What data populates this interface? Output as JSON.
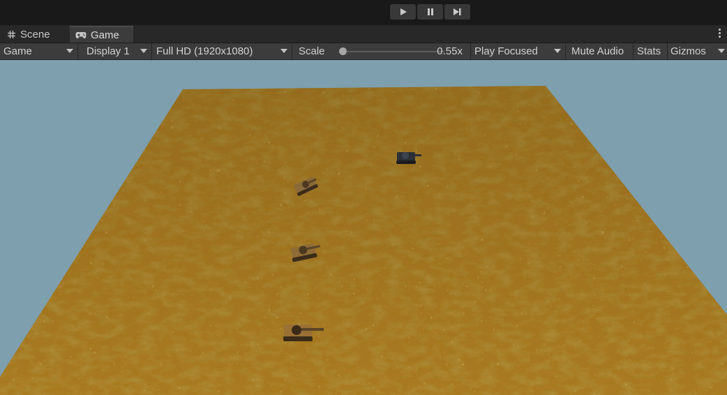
{
  "toolbar": {
    "play_icon": "play-icon",
    "pause_icon": "pause-icon",
    "step_icon": "step-icon"
  },
  "tabs": [
    {
      "label": "Scene",
      "icon": "grid-icon"
    },
    {
      "label": "Game",
      "icon": "gamepad-icon",
      "active": true
    }
  ],
  "game_toolbar": {
    "view_mode": "Game",
    "display": "Display 1",
    "resolution": "Full HD (1920x1080)",
    "scale_label": "Scale",
    "scale_value": "0.55x",
    "scale": 0.55,
    "play_mode": "Play Focused",
    "mute_audio": "Mute Audio",
    "stats": "Stats",
    "gizmos": "Gizmos"
  },
  "viewport": {
    "sky_color": "#7d9fae",
    "ground_color": "#a97a22",
    "tanks": [
      {
        "name": "tank-dark"
      },
      {
        "name": "tank-upper"
      },
      {
        "name": "tank-middle"
      },
      {
        "name": "tank-front"
      }
    ]
  }
}
